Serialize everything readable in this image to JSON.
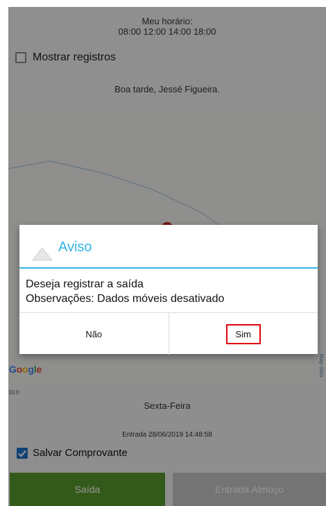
{
  "header": {
    "schedule_title": "Meu horário:",
    "schedule_times": "08:00 12:00 14:00 18:00",
    "show_records_label": "Mostrar registros",
    "greeting": "Boa tarde, Jessé Figueira."
  },
  "map": {
    "google_logo": [
      "G",
      "o",
      "o",
      "g",
      "l",
      "e"
    ],
    "side_text": "Map data",
    "zoom_readout": "10.0"
  },
  "dialog": {
    "title": "Aviso",
    "message_line1": "Deseja registrar a saída",
    "message_line2": "Observações:  Dados móveis desativado",
    "no_label": "Não",
    "yes_label": "Sim",
    "accent_color": "#33b5e5",
    "highlight_color": "#e0000b"
  },
  "info": {
    "weekday": "Sexta-Feira",
    "entry": "Entrada  28/06/2019 14:48:58"
  },
  "save_receipt": {
    "label": "Salvar Comprovante",
    "checked": true
  },
  "buttons": {
    "saida_label": "Saída",
    "almoco_label": "Entrada Almoço",
    "saida_color": "#5b9c2f",
    "almoco_color": "#c9c9c9"
  }
}
